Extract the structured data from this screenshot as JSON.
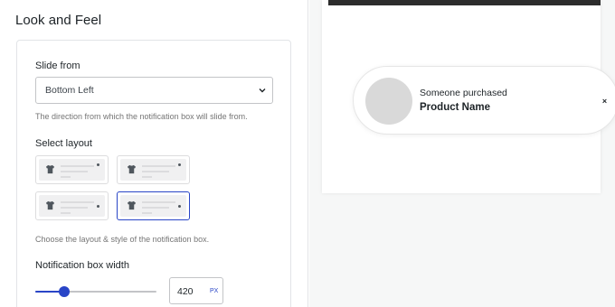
{
  "panel": {
    "title": "Look and Feel"
  },
  "slide_from": {
    "label": "Slide from",
    "value": "Bottom Left",
    "help": "The direction from which the notification box will slide from."
  },
  "layout": {
    "label": "Select layout",
    "help": "Choose the layout & style of the notification box.",
    "options": [
      {
        "icon": "tshirt-icon",
        "selected": false
      },
      {
        "icon": "tshirt-icon",
        "selected": false
      },
      {
        "icon": "tshirt-icon",
        "selected": false
      },
      {
        "icon": "tshirt-icon",
        "selected": true
      }
    ]
  },
  "box_width": {
    "label": "Notification box width",
    "value": "420",
    "unit": "PX",
    "slider_fraction": 0.24
  },
  "preview": {
    "line1": "Someone purchased",
    "line2": "Product Name",
    "close_glyph": "×"
  },
  "colors": {
    "accent": "#2945c7",
    "avatar": "#d9d9d9"
  }
}
